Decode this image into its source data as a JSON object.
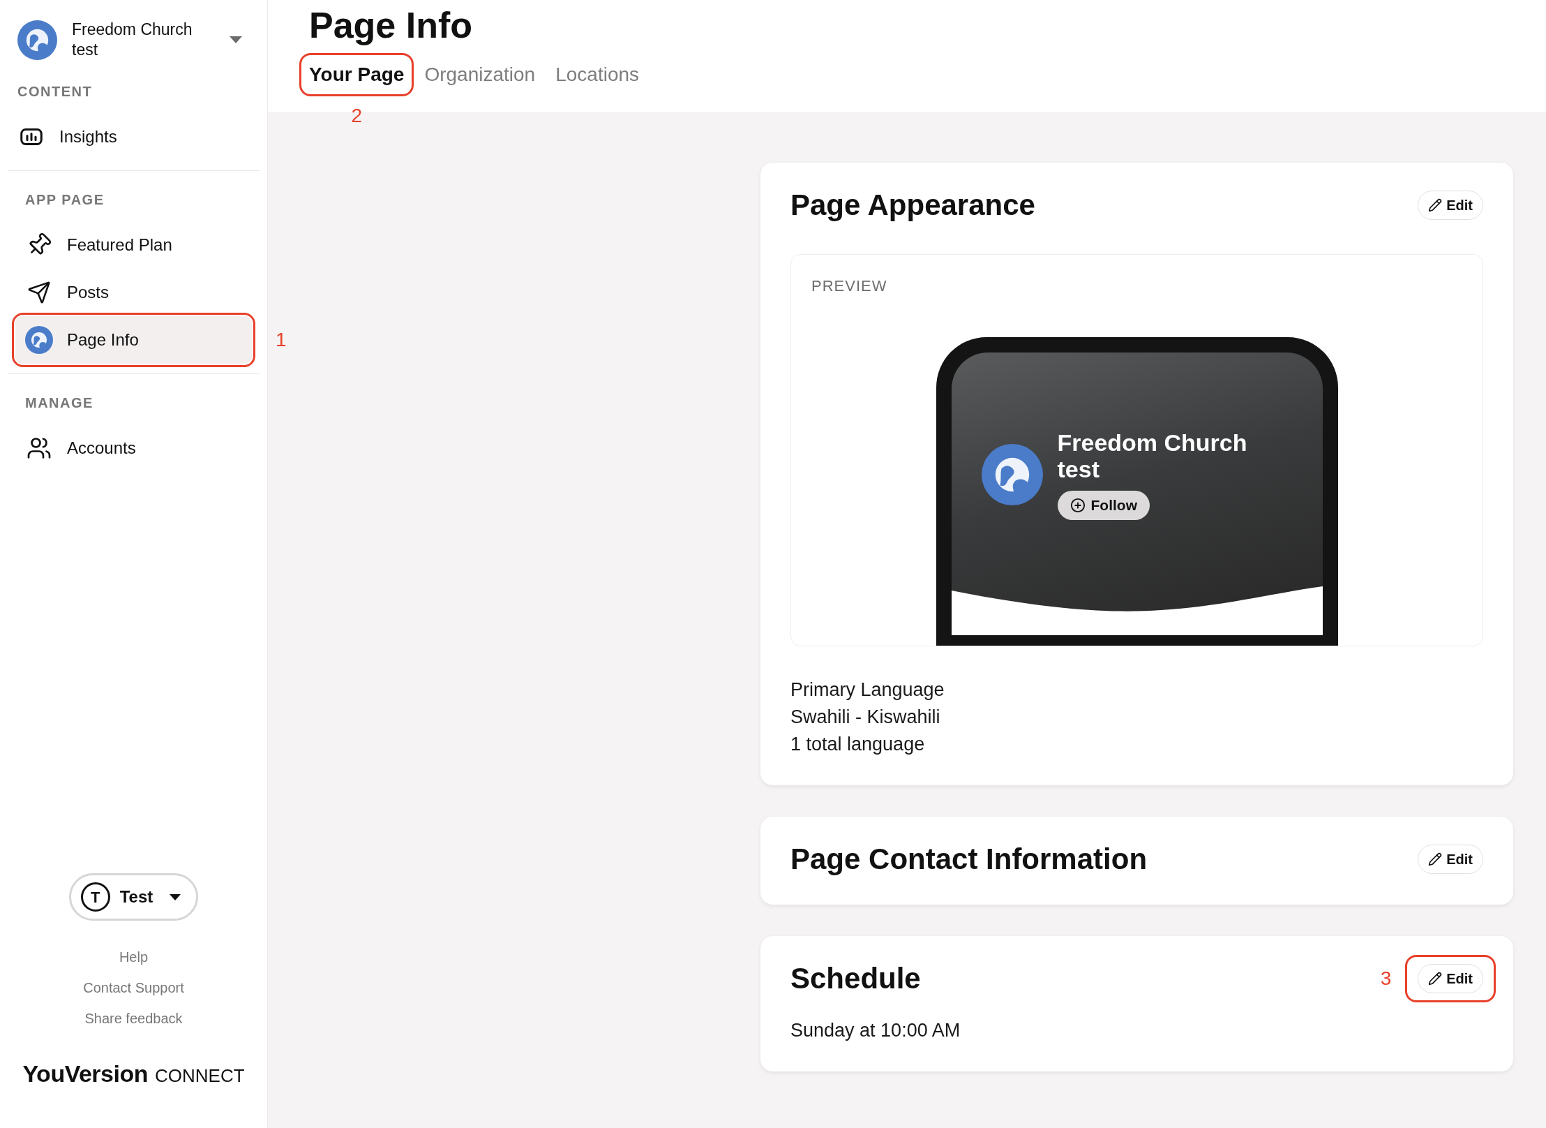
{
  "sidebar": {
    "org": {
      "name": "Freedom Church test"
    },
    "sections": [
      {
        "heading": "CONTENT",
        "items": [
          {
            "label": "Insights",
            "kind": "insights",
            "selected": false
          }
        ]
      },
      {
        "heading": "APP PAGE",
        "items": [
          {
            "label": "Featured Plan",
            "kind": "pin",
            "selected": false
          },
          {
            "label": "Posts",
            "kind": "send",
            "selected": false
          },
          {
            "label": "Page Info",
            "kind": "org",
            "selected": true,
            "annotation": "1"
          }
        ]
      },
      {
        "heading": "MANAGE",
        "items": [
          {
            "label": "Accounts",
            "kind": "users",
            "selected": false
          }
        ]
      }
    ],
    "user": {
      "initial": "T",
      "name": "Test"
    },
    "links": [
      "Help",
      "Contact Support",
      "Share feedback"
    ],
    "brand": {
      "name": "YouVersion",
      "suffix": "CONNECT"
    }
  },
  "page": {
    "title": "Page Info",
    "tabs": [
      {
        "label": "Your Page",
        "selected": true,
        "annotation": "2"
      },
      {
        "label": "Organization",
        "selected": false
      },
      {
        "label": "Locations",
        "selected": false
      }
    ]
  },
  "cards": [
    {
      "kind": "appearance",
      "title": "Page Appearance",
      "edit": {
        "label": "Edit"
      },
      "preview": {
        "label": "PREVIEW",
        "name": "Freedom Church test",
        "follow": "Follow"
      },
      "lines": [
        "Primary Language",
        "Swahili - Kiswahili",
        "1 total language"
      ]
    },
    {
      "kind": "plain",
      "title": "Page Contact Information",
      "edit": {
        "label": "Edit"
      }
    },
    {
      "kind": "schedule",
      "title": "Schedule",
      "edit": {
        "label": "Edit",
        "annotation": "3"
      },
      "lines": [
        "Sunday at 10:00 AM"
      ]
    }
  ]
}
